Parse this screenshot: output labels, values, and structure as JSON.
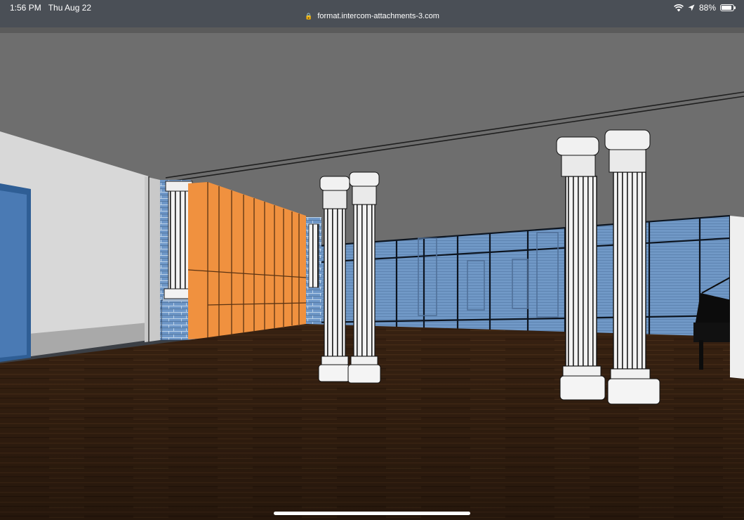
{
  "status_bar": {
    "time": "1:56 PM",
    "date": "Thu Aug 22",
    "url": "format.intercom-attachments-3.com",
    "battery_percent": "88%",
    "battery_level": 0.88,
    "icons": [
      "lock-icon",
      "wifi-icon",
      "location-arrow-icon",
      "battery-icon"
    ]
  },
  "scene": {
    "colors": {
      "ceiling": "#6e6e6e",
      "floor": "#3a2312",
      "wall": "#d9d9d9",
      "orange_panels": "#f0913f",
      "window_blue": "#6f94c2",
      "column": "#f0f0f0"
    }
  }
}
